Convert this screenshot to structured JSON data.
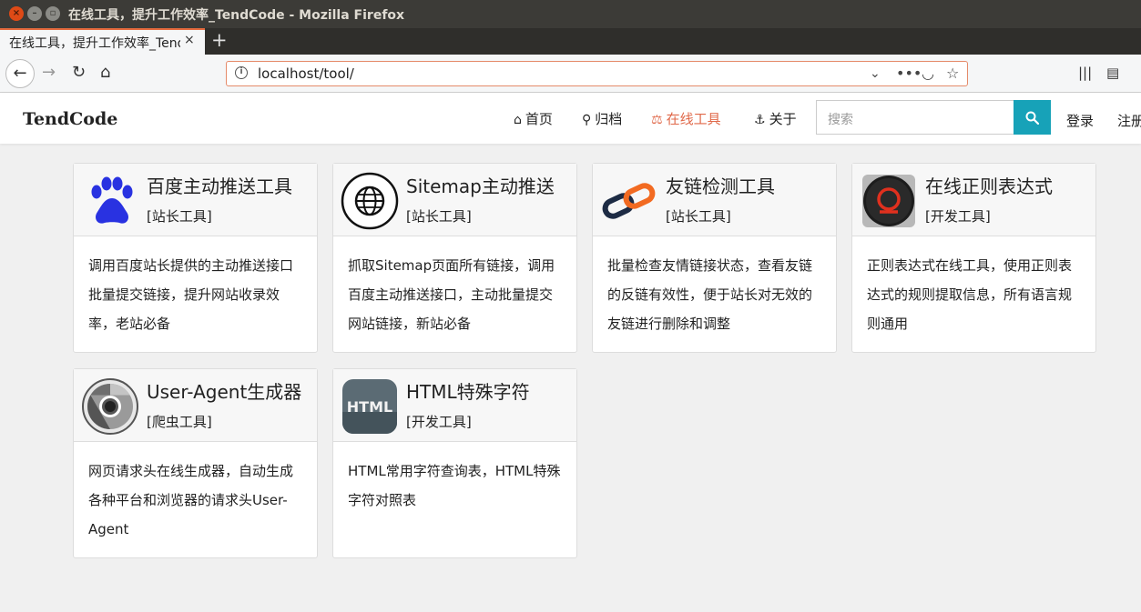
{
  "window": {
    "title": "在线工具，提升工作效率_TendCode - Mozilla Firefox"
  },
  "tab": {
    "title": "在线工具，提升工作效率_TendCode",
    "close": "×",
    "new": "+"
  },
  "browser": {
    "url": "localhost/tool/"
  },
  "site": {
    "logo": "TendCode",
    "nav": [
      {
        "label": "首页",
        "icon": "home-icon"
      },
      {
        "label": "归档",
        "icon": "sitemap-icon"
      },
      {
        "label": "在线工具",
        "icon": "balance-scale-icon"
      },
      {
        "label": "关于",
        "icon": "anchor-icon"
      }
    ],
    "search": {
      "placeholder": "搜索"
    },
    "login": "登录",
    "register": "注册"
  },
  "colors": {
    "accent": "#e0694a",
    "search_button": "#17a2b8"
  },
  "tools": [
    {
      "title": "百度主动推送工具",
      "category": "[站长工具]",
      "description": "调用百度站长提供的主动推送接口批量提交链接，提升网站收录效率，老站必备",
      "icon": "baidu-paw-icon"
    },
    {
      "title": "Sitemap主动推送",
      "category": "[站长工具]",
      "description": "抓取Sitemap页面所有链接，调用百度主动推送接口，主动批量提交网站链接，新站必备",
      "icon": "globe-icon"
    },
    {
      "title": "友链检测工具",
      "category": "[站长工具]",
      "description": "批量检查友情链接状态，查看友链的反链有效性，便于站长对无效的友链进行删除和调整",
      "icon": "chain-link-icon"
    },
    {
      "title": "在线正则表达式",
      "category": "[开发工具]",
      "description": "正则表达式在线工具，使用正则表达式的规则提取信息，所有语言规则通用",
      "icon": "regex-icon"
    },
    {
      "title": "User-Agent生成器",
      "category": "[爬虫工具]",
      "description": "网页请求头在线生成器，自动生成各种平台和浏览器的请求头User-Agent",
      "icon": "chrome-icon"
    },
    {
      "title": "HTML特殊字符",
      "category": "[开发工具]",
      "description": "HTML常用字符查询表，HTML特殊字符对照表",
      "icon": "html-icon"
    }
  ]
}
